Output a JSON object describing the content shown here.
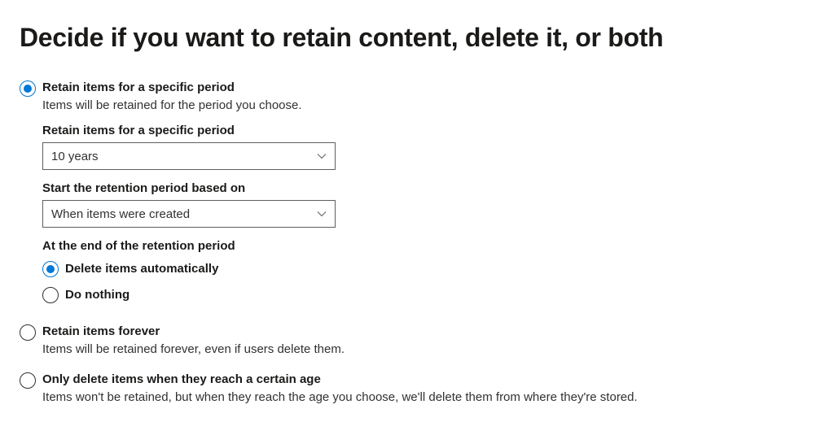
{
  "title": "Decide if you want to retain content, delete it, or both",
  "options": {
    "retain_period": {
      "label": "Retain items for a specific period",
      "description": "Items will be retained for the period you choose.",
      "selected": true
    },
    "retain_forever": {
      "label": "Retain items forever",
      "description": "Items will be retained forever, even if users delete them.",
      "selected": false
    },
    "only_delete": {
      "label": "Only delete items when they reach a certain age",
      "description": "Items won't be retained, but when they reach the age you choose, we'll delete them from where they're stored.",
      "selected": false
    }
  },
  "retain_period_section": {
    "period_label": "Retain items for a specific period",
    "period_value": "10 years",
    "start_label": "Start the retention period based on",
    "start_value": "When items were created",
    "end_label": "At the end of the retention period",
    "end_options": {
      "delete_auto": {
        "label": "Delete items automatically",
        "selected": true
      },
      "do_nothing": {
        "label": "Do nothing",
        "selected": false
      }
    }
  }
}
